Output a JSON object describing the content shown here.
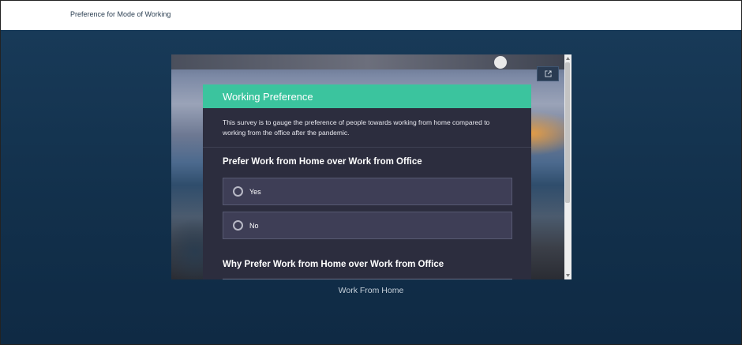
{
  "header": {
    "title": "Preference for Mode of Working"
  },
  "survey": {
    "title": "Working Preference",
    "description": "This survey is to gauge the preference of people towards working from home compared to working from the office after the pandemic.",
    "question1": {
      "label": "Prefer Work from Home over Work from Office",
      "options": [
        "Yes",
        "No"
      ]
    },
    "question2": {
      "label": "Why Prefer Work from Home over Work from Office"
    }
  },
  "embed": {
    "open_external_icon": "external-link-icon"
  },
  "caption": "Work From Home",
  "colors": {
    "accent": "#3bc49e",
    "panel": "#2c2d3e",
    "page_bg": "#12304a"
  }
}
